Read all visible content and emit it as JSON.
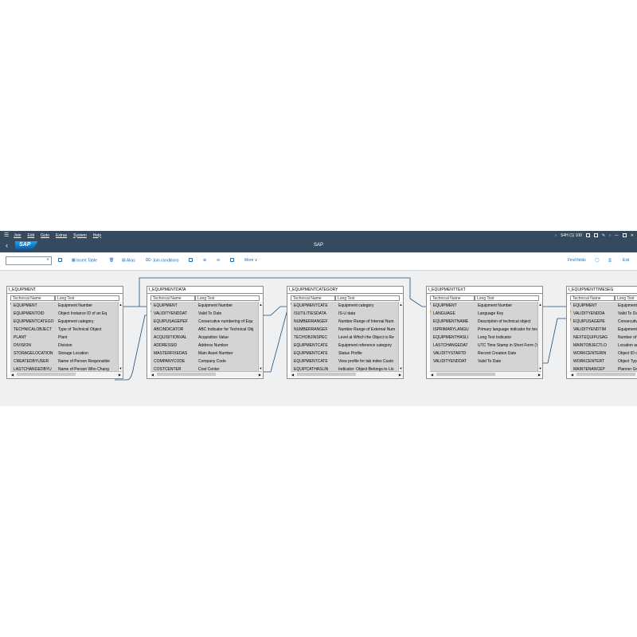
{
  "menu": {
    "items": [
      "Join",
      "Edit",
      "Goto",
      "Extras",
      "System",
      "Help"
    ],
    "session": "S4H (1) 100"
  },
  "titlebar": {
    "logo": "SAP",
    "title": "SAP"
  },
  "toolbar": {
    "insert_table": "Insert Table",
    "alias": "Alias",
    "join_conditions": "Join conditions",
    "more": "More",
    "find_fields": "Find fields",
    "exit": "Exit"
  },
  "tables": [
    {
      "name": "I_EQUIPMENT",
      "col1": "Technical Name",
      "col2": "Long Text",
      "rows": [
        {
          "tech": "EQUIPMENT",
          "text": "Equipment Number",
          "key": true
        },
        {
          "tech": "EQUIPMENTOID",
          "text": "Object Instance ID of an Eq",
          "key": false
        },
        {
          "tech": "EQUIPMENTCATEGO",
          "text": "Equipment category",
          "key": false
        },
        {
          "tech": "TECHNICALOBJECT",
          "text": "Type of Technical Object",
          "key": false
        },
        {
          "tech": "PLANT",
          "text": "Plant",
          "key": false
        },
        {
          "tech": "DIVISION",
          "text": "Division",
          "key": false
        },
        {
          "tech": "STORAGELOCATION",
          "text": "Storage Location",
          "key": false
        },
        {
          "tech": "CREATEDBYUSER",
          "text": "Name of Person Responsible",
          "key": false
        },
        {
          "tech": "LASTCHANGEDBYU",
          "text": "Name of Person Who Chang",
          "key": false
        }
      ]
    },
    {
      "name": "I_EQUIPMENTDATA",
      "col1": "Technical Name",
      "col2": "Long Text",
      "rows": [
        {
          "tech": "EQUIPMENT",
          "text": "Equipment Number",
          "key": true
        },
        {
          "tech": "VALIDITYENDDAT",
          "text": "Valid To Date",
          "key": true
        },
        {
          "tech": "EQUIPUSAGEPEF",
          "text": "Consecutive numbering of Equ",
          "key": false
        },
        {
          "tech": "ABCINDICATOR",
          "text": "ABC Indicator for Technical Obj",
          "key": false
        },
        {
          "tech": "ACQUISITIONVAL",
          "text": "Acquisition Value",
          "key": false
        },
        {
          "tech": "ADDRESSID",
          "text": "Address Number",
          "key": false
        },
        {
          "tech": "MASTERFIXEDAS",
          "text": "Main Asset Number",
          "key": false
        },
        {
          "tech": "COMPANYCODE",
          "text": "Company Code",
          "key": false
        },
        {
          "tech": "COSTCENTER",
          "text": "Cost Center",
          "key": false
        }
      ]
    },
    {
      "name": "I_EQUIPMENTCATEGORY",
      "col1": "Technical Name",
      "col2": "Long Text",
      "rows": [
        {
          "tech": "EQUIPMENTCATE",
          "text": "Equipment category",
          "key": true
        },
        {
          "tech": "ISUTILITIESDATA",
          "text": "IS-U data",
          "key": false
        },
        {
          "tech": "NUMBERRANGEF",
          "text": "Number Range of Internal Num",
          "key": false
        },
        {
          "tech": "NUMBERRANGEF",
          "text": "Number Range of External Num",
          "key": false
        },
        {
          "tech": "TECHOBJINSPEC",
          "text": "Level at Which the Object is Re",
          "key": false
        },
        {
          "tech": "EQUIPMENTCATE",
          "text": "Equipment reference category",
          "key": false
        },
        {
          "tech": "EQUIPMENTCATE",
          "text": "Status Profile",
          "key": false
        },
        {
          "tech": "EQUIPMENTCATE",
          "text": "View profile for tab index Custo",
          "key": false
        },
        {
          "tech": "EQUIPCATHASLIN",
          "text": "Indicator: Object Belongs to Lin",
          "key": false
        }
      ]
    },
    {
      "name": "I_EQUIPMENTTEXT",
      "col1": "Technical Name",
      "col2": "Long Text",
      "rows": [
        {
          "tech": "EQUIPMENT",
          "text": "Equipment Number",
          "key": true
        },
        {
          "tech": "LANGUAGE",
          "text": "Language Key",
          "key": true
        },
        {
          "tech": "EQUIPMENTNAME",
          "text": "Description of technical object",
          "key": false
        },
        {
          "tech": "ISPRIMARYLANGU",
          "text": "Primary language indicator for text",
          "key": false
        },
        {
          "tech": "EQUIPMENTHASLI",
          "text": "Long Text Indicator",
          "key": false
        },
        {
          "tech": "LASTCHANGEDAT",
          "text": "UTC Time Stamp in Short Form (Y",
          "key": false
        },
        {
          "tech": "VALIDITYSTARTD",
          "text": "Record Creation Date",
          "key": false
        },
        {
          "tech": "VALIDITYENDDAT",
          "text": "Valid To Date",
          "key": false
        }
      ]
    },
    {
      "name": "I_EQUIPMENTTIMESEG",
      "col1": "Technical Name",
      "col2": "Long Text",
      "rows": [
        {
          "tech": "EQUIPMENT",
          "text": "Equipment N",
          "key": true
        },
        {
          "tech": "VALIDITYENDDA",
          "text": "Valid To Da",
          "key": true
        },
        {
          "tech": "EQUIPUSAGEPE",
          "text": "Consecutiv",
          "key": true
        },
        {
          "tech": "VALIDITYENDTIM",
          "text": "Equipment",
          "key": false
        },
        {
          "tech": "NEXTEQUIPUSAG",
          "text": "Number of",
          "key": false
        },
        {
          "tech": "MAINTOBJECTLO",
          "text": "Location an",
          "key": false
        },
        {
          "tech": "WORKCENTERIN",
          "text": "Object ID o",
          "key": false
        },
        {
          "tech": "WORKCENTERT",
          "text": "Object Type",
          "key": false
        },
        {
          "tech": "MAINTENANCEP",
          "text": "Planner Gro",
          "key": false
        }
      ]
    }
  ]
}
